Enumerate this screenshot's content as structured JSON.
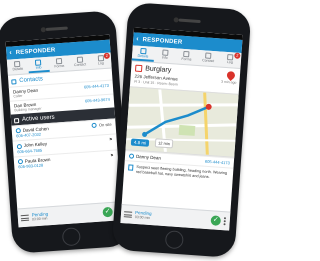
{
  "left_phone": {
    "app_title": "RESPONDER",
    "tabs": [
      {
        "label": "Details",
        "icon": "details-icon"
      },
      {
        "label": "Info",
        "icon": "info-icon"
      },
      {
        "label": "Forms",
        "icon": "forms-icon"
      },
      {
        "label": "Contact",
        "icon": "contact-icon"
      },
      {
        "label": "Log",
        "icon": "log-icon",
        "badge": "2"
      }
    ],
    "active_tab": "Info",
    "contacts": {
      "heading": "Contacts",
      "items": [
        {
          "name": "Danny Dean",
          "role": "Caller",
          "phone": "605-444-4173"
        },
        {
          "name": "Dan Brown",
          "role": "Building manager",
          "phone": "605-443-9674"
        }
      ]
    },
    "active_users": {
      "heading": "Active users",
      "items": [
        {
          "name": "David Cohen",
          "phone": "605-407-2032",
          "status": "On site"
        },
        {
          "name": "John Kelley",
          "phone": "605-664-7585",
          "status": ""
        },
        {
          "name": "Paula Brown",
          "phone": "605-983-0128",
          "status": ""
        }
      ]
    },
    "footer": {
      "status": "Pending",
      "time": "03:00 min"
    }
  },
  "right_phone": {
    "app_title": "RESPONDER",
    "tabs": [
      {
        "label": "Details",
        "icon": "details-icon"
      },
      {
        "label": "Info",
        "icon": "info-icon"
      },
      {
        "label": "Forms",
        "icon": "forms-icon"
      },
      {
        "label": "Contact",
        "icon": "contact-icon"
      },
      {
        "label": "Log",
        "icon": "log-icon",
        "badge": "2"
      }
    ],
    "active_tab": "Details",
    "incident": {
      "type": "Burglary",
      "address": "226 Jefferson Avenue",
      "meta": "Fl 3 · Unit 15 · Room: Boom",
      "ago": "3 min ago"
    },
    "map": {
      "distance": "4.8 mi",
      "eta": "12 min"
    },
    "caller": {
      "name": "Danny Dean",
      "phone": "605-444-4173"
    },
    "description": "Suspect seen fleeing building, heading north. Wearing red baseball hat, navy sweatshirt and jeans.",
    "footer": {
      "status": "Pending",
      "time": "03:00 min"
    }
  }
}
